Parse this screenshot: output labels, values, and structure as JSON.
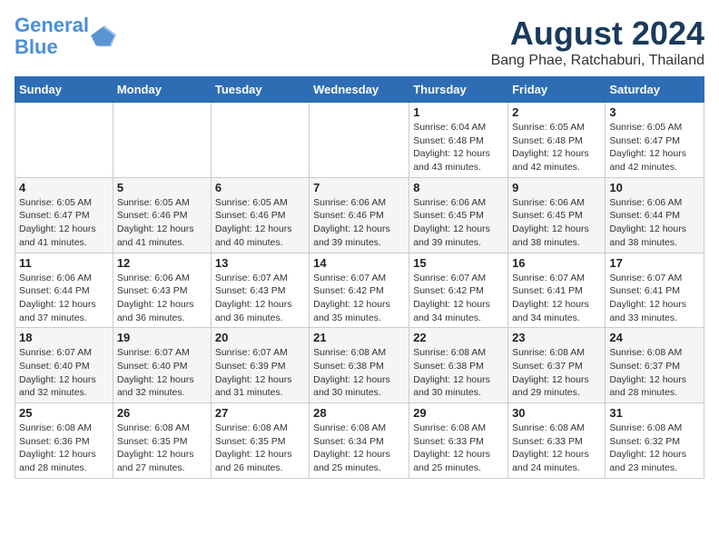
{
  "header": {
    "logo_line1": "General",
    "logo_line2": "Blue",
    "title": "August 2024",
    "subtitle": "Bang Phae, Ratchaburi, Thailand"
  },
  "weekdays": [
    "Sunday",
    "Monday",
    "Tuesday",
    "Wednesday",
    "Thursday",
    "Friday",
    "Saturday"
  ],
  "weeks": [
    [
      {
        "day": "",
        "info": ""
      },
      {
        "day": "",
        "info": ""
      },
      {
        "day": "",
        "info": ""
      },
      {
        "day": "",
        "info": ""
      },
      {
        "day": "1",
        "info": "Sunrise: 6:04 AM\nSunset: 6:48 PM\nDaylight: 12 hours and 43 minutes."
      },
      {
        "day": "2",
        "info": "Sunrise: 6:05 AM\nSunset: 6:48 PM\nDaylight: 12 hours and 42 minutes."
      },
      {
        "day": "3",
        "info": "Sunrise: 6:05 AM\nSunset: 6:47 PM\nDaylight: 12 hours and 42 minutes."
      }
    ],
    [
      {
        "day": "4",
        "info": "Sunrise: 6:05 AM\nSunset: 6:47 PM\nDaylight: 12 hours and 41 minutes."
      },
      {
        "day": "5",
        "info": "Sunrise: 6:05 AM\nSunset: 6:46 PM\nDaylight: 12 hours and 41 minutes."
      },
      {
        "day": "6",
        "info": "Sunrise: 6:05 AM\nSunset: 6:46 PM\nDaylight: 12 hours and 40 minutes."
      },
      {
        "day": "7",
        "info": "Sunrise: 6:06 AM\nSunset: 6:46 PM\nDaylight: 12 hours and 39 minutes."
      },
      {
        "day": "8",
        "info": "Sunrise: 6:06 AM\nSunset: 6:45 PM\nDaylight: 12 hours and 39 minutes."
      },
      {
        "day": "9",
        "info": "Sunrise: 6:06 AM\nSunset: 6:45 PM\nDaylight: 12 hours and 38 minutes."
      },
      {
        "day": "10",
        "info": "Sunrise: 6:06 AM\nSunset: 6:44 PM\nDaylight: 12 hours and 38 minutes."
      }
    ],
    [
      {
        "day": "11",
        "info": "Sunrise: 6:06 AM\nSunset: 6:44 PM\nDaylight: 12 hours and 37 minutes."
      },
      {
        "day": "12",
        "info": "Sunrise: 6:06 AM\nSunset: 6:43 PM\nDaylight: 12 hours and 36 minutes."
      },
      {
        "day": "13",
        "info": "Sunrise: 6:07 AM\nSunset: 6:43 PM\nDaylight: 12 hours and 36 minutes."
      },
      {
        "day": "14",
        "info": "Sunrise: 6:07 AM\nSunset: 6:42 PM\nDaylight: 12 hours and 35 minutes."
      },
      {
        "day": "15",
        "info": "Sunrise: 6:07 AM\nSunset: 6:42 PM\nDaylight: 12 hours and 34 minutes."
      },
      {
        "day": "16",
        "info": "Sunrise: 6:07 AM\nSunset: 6:41 PM\nDaylight: 12 hours and 34 minutes."
      },
      {
        "day": "17",
        "info": "Sunrise: 6:07 AM\nSunset: 6:41 PM\nDaylight: 12 hours and 33 minutes."
      }
    ],
    [
      {
        "day": "18",
        "info": "Sunrise: 6:07 AM\nSunset: 6:40 PM\nDaylight: 12 hours and 32 minutes."
      },
      {
        "day": "19",
        "info": "Sunrise: 6:07 AM\nSunset: 6:40 PM\nDaylight: 12 hours and 32 minutes."
      },
      {
        "day": "20",
        "info": "Sunrise: 6:07 AM\nSunset: 6:39 PM\nDaylight: 12 hours and 31 minutes."
      },
      {
        "day": "21",
        "info": "Sunrise: 6:08 AM\nSunset: 6:38 PM\nDaylight: 12 hours and 30 minutes."
      },
      {
        "day": "22",
        "info": "Sunrise: 6:08 AM\nSunset: 6:38 PM\nDaylight: 12 hours and 30 minutes."
      },
      {
        "day": "23",
        "info": "Sunrise: 6:08 AM\nSunset: 6:37 PM\nDaylight: 12 hours and 29 minutes."
      },
      {
        "day": "24",
        "info": "Sunrise: 6:08 AM\nSunset: 6:37 PM\nDaylight: 12 hours and 28 minutes."
      }
    ],
    [
      {
        "day": "25",
        "info": "Sunrise: 6:08 AM\nSunset: 6:36 PM\nDaylight: 12 hours and 28 minutes."
      },
      {
        "day": "26",
        "info": "Sunrise: 6:08 AM\nSunset: 6:35 PM\nDaylight: 12 hours and 27 minutes."
      },
      {
        "day": "27",
        "info": "Sunrise: 6:08 AM\nSunset: 6:35 PM\nDaylight: 12 hours and 26 minutes."
      },
      {
        "day": "28",
        "info": "Sunrise: 6:08 AM\nSunset: 6:34 PM\nDaylight: 12 hours and 25 minutes."
      },
      {
        "day": "29",
        "info": "Sunrise: 6:08 AM\nSunset: 6:33 PM\nDaylight: 12 hours and 25 minutes."
      },
      {
        "day": "30",
        "info": "Sunrise: 6:08 AM\nSunset: 6:33 PM\nDaylight: 12 hours and 24 minutes."
      },
      {
        "day": "31",
        "info": "Sunrise: 6:08 AM\nSunset: 6:32 PM\nDaylight: 12 hours and 23 minutes."
      }
    ]
  ]
}
